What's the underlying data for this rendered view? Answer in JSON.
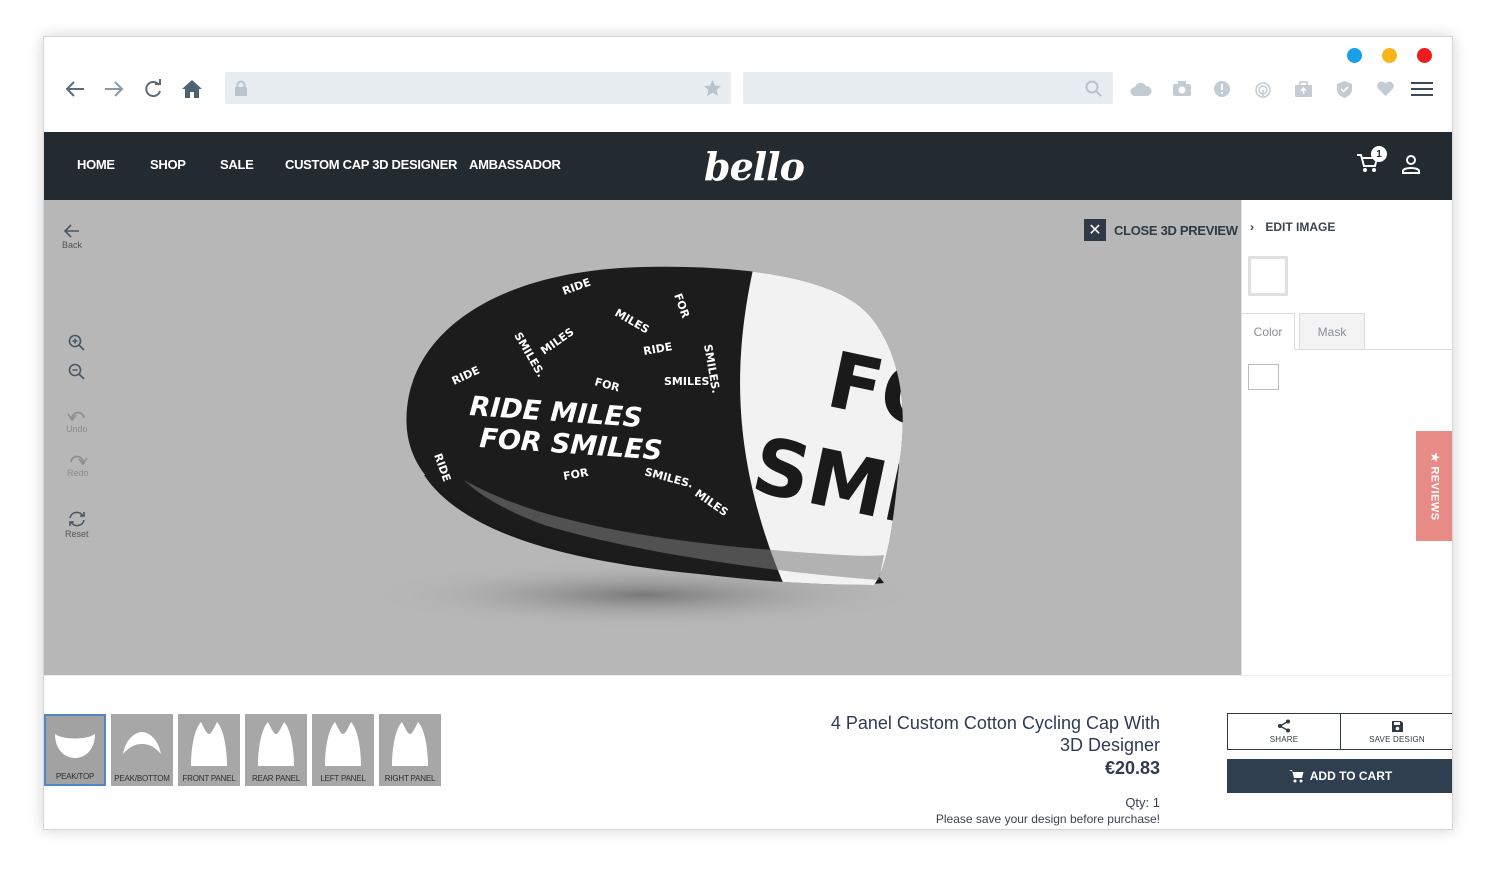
{
  "site": {
    "logo": "bello",
    "menu": [
      "HOME",
      "SHOP",
      "SALE",
      "CUSTOM CAP 3D DESIGNER",
      "AMBASSADOR"
    ],
    "cart_count": "1"
  },
  "browser": {
    "url": "",
    "search": "",
    "window_dot_colors": [
      "#1aa0e6",
      "#f7b519",
      "#ee1c1c"
    ]
  },
  "viewer": {
    "back_label": "Back",
    "undo_label": "Undo",
    "redo_label": "Redo",
    "reset_label": "Reset",
    "close_preview_label": "CLOSE 3D PREVIEW",
    "cap_text_main": [
      "RIDE MILES",
      "FOR SMILES"
    ],
    "cap_text_side": [
      "FO",
      "SMIL"
    ],
    "cap_pattern_words": [
      "RIDE",
      "MILES",
      "FOR",
      "SMILES."
    ]
  },
  "panel": {
    "edit_image_label": "EDIT IMAGE",
    "tabs": [
      "Color",
      "Mask"
    ],
    "reviews_label": "★ REVIEWS"
  },
  "parts": [
    {
      "label": "PEAK/TOP",
      "selected": true
    },
    {
      "label": "PEAK/BOTTOM",
      "selected": false
    },
    {
      "label": "FRONT PANEL",
      "selected": false
    },
    {
      "label": "REAR PANEL",
      "selected": false
    },
    {
      "label": "LEFT PANEL",
      "selected": false
    },
    {
      "label": "RIGHT PANEL",
      "selected": false
    }
  ],
  "product": {
    "title": "4 Panel Custom Cotton Cycling Cap With 3D Designer",
    "price": "€20.83",
    "qty": "Qty: 1",
    "save_note": "Please save your design before purchase!"
  },
  "actions": {
    "share_label": "SHARE",
    "save_design_label": "SAVE DESIGN",
    "add_to_cart_label": "ADD TO CART"
  }
}
